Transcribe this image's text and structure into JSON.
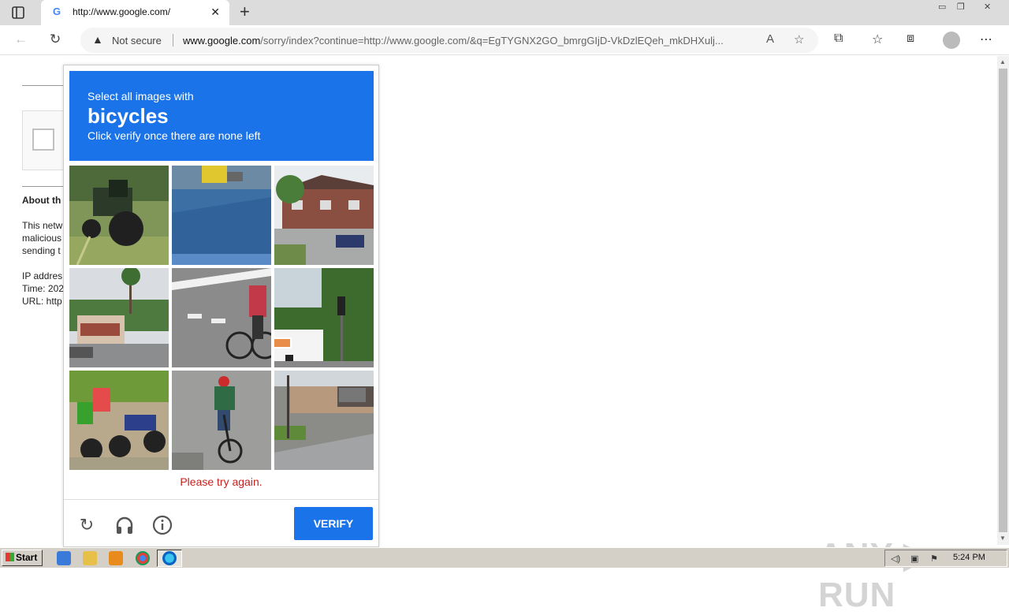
{
  "browser": {
    "tab_title": "http://www.google.com/",
    "security_label": "Not secure",
    "url_domain": "www.google.com",
    "url_path": "/sorry/index?continue=http://www.google.com/&q=EgTYGNX2GO_bmrgGIjD-VkDzlEQeh_mkDHXulj...",
    "icons": [
      "sidebar-icon",
      "close-icon",
      "plus-icon",
      "back-icon",
      "reload-icon",
      "warning-icon",
      "read-aloud-icon",
      "favorite-add-icon",
      "extensions-icon",
      "favorites-icon",
      "collections-icon",
      "profile-icon",
      "more-icon"
    ]
  },
  "background_page": {
    "heading": "About th",
    "para_lines": [
      "This netw",
      "malicious",
      "sending t"
    ],
    "info_lines": [
      "IP addres",
      "Time: 202",
      "URL: http"
    ]
  },
  "recaptcha": {
    "instruction_top": "Select all images with",
    "target": "bicycles",
    "instruction_bottom": "Click verify once there are none left",
    "tiles": [
      {
        "id": 1,
        "desc": "tractor-field"
      },
      {
        "id": 2,
        "desc": "wet-road-truck"
      },
      {
        "id": 3,
        "desc": "brick-houses-car"
      },
      {
        "id": 4,
        "desc": "palm-tree-building"
      },
      {
        "id": 5,
        "desc": "cyclist-crosswalk"
      },
      {
        "id": 6,
        "desc": "traffic-light-van"
      },
      {
        "id": 7,
        "desc": "motorcycles-riders"
      },
      {
        "id": 8,
        "desc": "cyclist-street"
      },
      {
        "id": 9,
        "desc": "driveway-street-sign"
      }
    ],
    "error": "Please try again.",
    "verify_label": "VERIFY",
    "accent_color": "#1a73e8"
  },
  "watermark": "ANY ▷ RUN",
  "taskbar": {
    "start_label": "Start",
    "clock": "5:24 PM"
  }
}
